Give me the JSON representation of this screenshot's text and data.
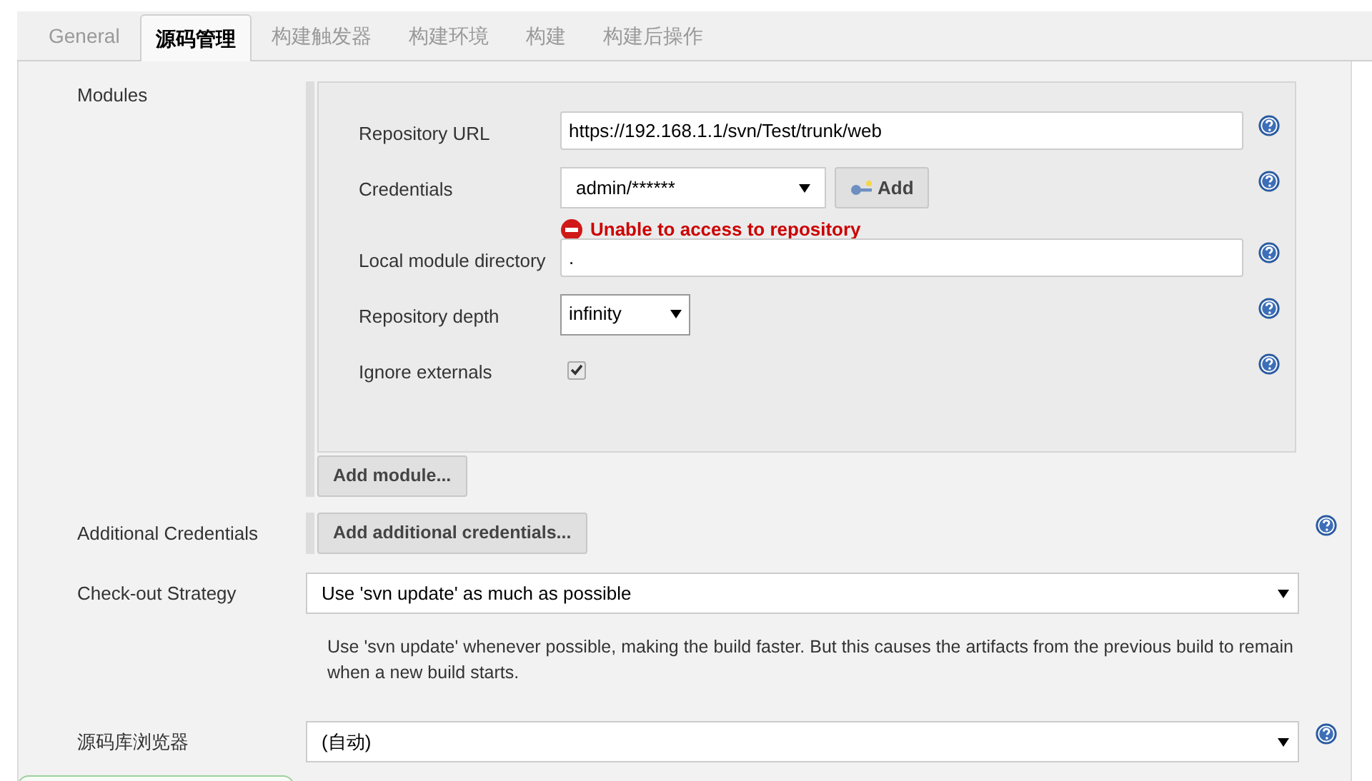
{
  "tabs": [
    {
      "label": "General",
      "selected": false
    },
    {
      "label": "源码管理",
      "selected": true
    },
    {
      "label": "构建触发器",
      "selected": false
    },
    {
      "label": "构建环境",
      "selected": false
    },
    {
      "label": "构建",
      "selected": false
    },
    {
      "label": "构建后操作",
      "selected": false
    }
  ],
  "modules": {
    "label": "Modules",
    "fields": [
      {
        "kind": "text",
        "label": "Repository URL",
        "value": "https://192.168.1.1/svn/Test/trunk/web"
      },
      {
        "kind": "credentials",
        "label": "Credentials",
        "value": "admin/******",
        "button": "Add",
        "error": "Unable to access to repository"
      },
      {
        "kind": "text",
        "label": "Local module directory",
        "value": "."
      },
      {
        "kind": "select",
        "label": "Repository depth",
        "value": "infinity"
      },
      {
        "kind": "checkbox",
        "label": "Ignore externals",
        "checked": true
      }
    ],
    "add_button": "Add module..."
  },
  "additional_credentials": {
    "label": "Additional Credentials",
    "button": "Add additional credentials..."
  },
  "checkout_strategy": {
    "label": "Check-out Strategy",
    "value": "Use 'svn update' as much as possible",
    "description": "Use 'svn update' whenever possible, making the build faster. But this causes the artifacts from the previous build to remain when a new build starts."
  },
  "repository_browser": {
    "label": "源码库浏览器",
    "value": "(自动)"
  }
}
